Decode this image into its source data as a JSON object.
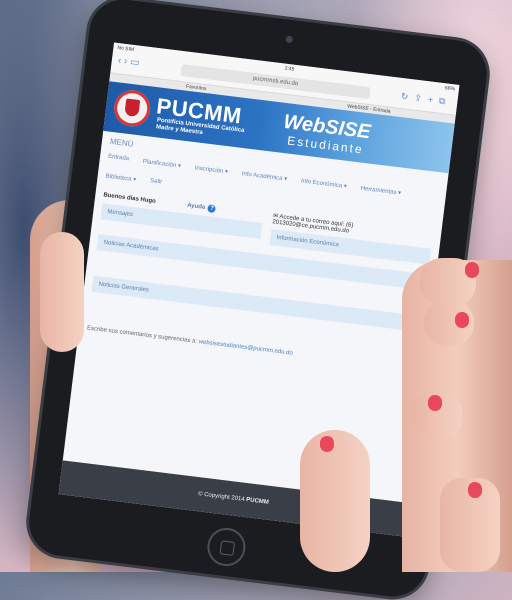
{
  "status_bar": {
    "carrier": "No SIM",
    "time": "2:45",
    "battery": "66%"
  },
  "browser": {
    "url": "pucmmsti.edu.do",
    "tabs": [
      "Favoritos",
      "WebSISE - Entrada"
    ]
  },
  "header": {
    "brand": "PUCMM",
    "brand_sub_line1": "Pontificia Universidad Católica",
    "brand_sub_line2": "Madre y Maestra",
    "product": "WebSISE",
    "product_sub": "Estudiante"
  },
  "menu": {
    "label": "MENÚ",
    "items": [
      "Entrada",
      "Planificación ▾",
      "Inscripción ▾",
      "Info Académica ▾",
      "Info Económica ▾",
      "Herramientas ▾",
      "Biblioteca ▾",
      "Salir"
    ]
  },
  "main": {
    "greeting": "Buenos días Hugo",
    "help_label": "Ayuda",
    "mail_text": "Accede a tu correo aquí: (6)",
    "mail_address": "2013020@ce.pucmm.edu.do",
    "panels": {
      "mensajes": "Mensajes",
      "info_economica": "Información Económica",
      "noticias_academicas": "Noticias Académicas",
      "noticias_generales": "Noticias Generales"
    },
    "feedback_text": "Escribe sus comentarios y sugerencias a:",
    "feedback_email": "websisestudiantes@pucmm.edu.do"
  },
  "footer": {
    "copyright": "© Copyright 2014",
    "brand": "PUCMM"
  },
  "colors": {
    "header_blue": "#1e5aa8",
    "nail_red": "#e8475c"
  }
}
